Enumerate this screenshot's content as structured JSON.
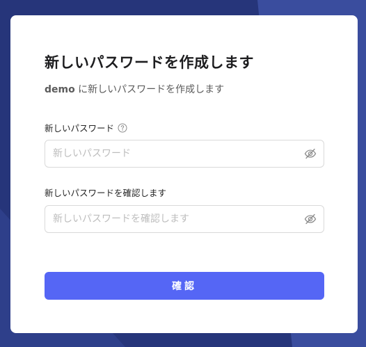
{
  "theme": {
    "background": "#26357a",
    "accent": "#5566f5",
    "card": "#ffffff"
  },
  "form": {
    "title": "新しいパスワードを作成します",
    "subtitle_user": "demo",
    "subtitle_text": " に新しいパスワードを作成します",
    "new_password": {
      "label": "新しいパスワード",
      "placeholder": "新しいパスワード",
      "value": ""
    },
    "confirm_password": {
      "label": "新しいパスワードを確認します",
      "placeholder": "新しいパスワードを確認します",
      "value": ""
    },
    "submit_label": "確認"
  },
  "icons": {
    "help": "question-circle-icon",
    "visibility": "eye-invisible-icon"
  }
}
